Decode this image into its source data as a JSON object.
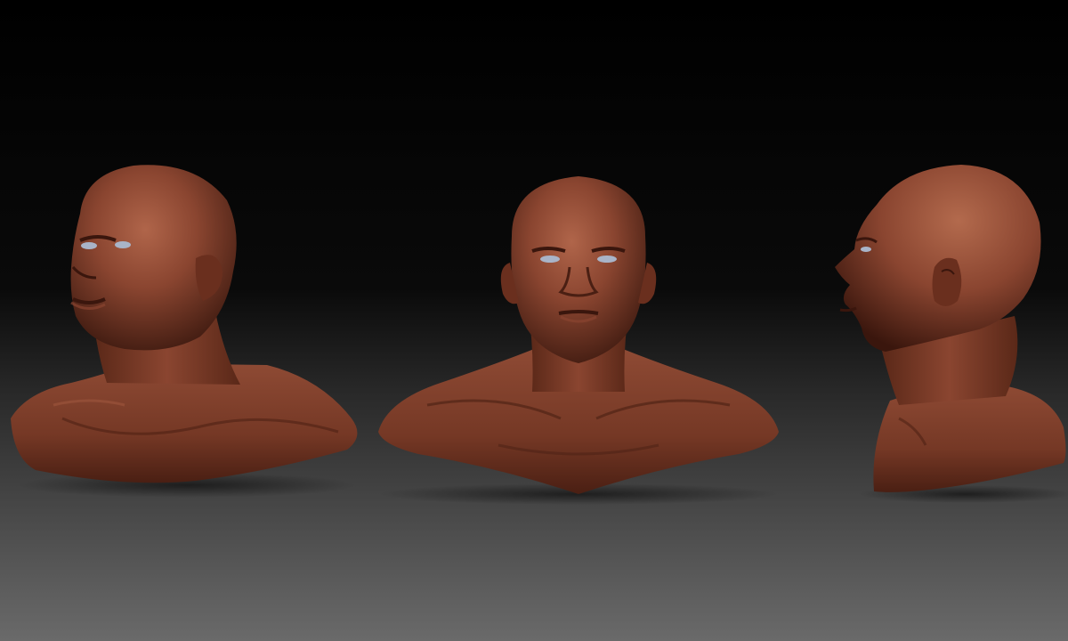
{
  "scene": {
    "views": [
      {
        "label": "three-quarter-view"
      },
      {
        "label": "front-view"
      },
      {
        "label": "profile-view"
      }
    ],
    "colors": {
      "background_top": "#000000",
      "background_bottom": "#6a6a6a",
      "skin_light": "#a0573f",
      "skin_mid": "#7a3a26",
      "skin_dark": "#3a160d",
      "eye": "#a9b4c8"
    }
  }
}
